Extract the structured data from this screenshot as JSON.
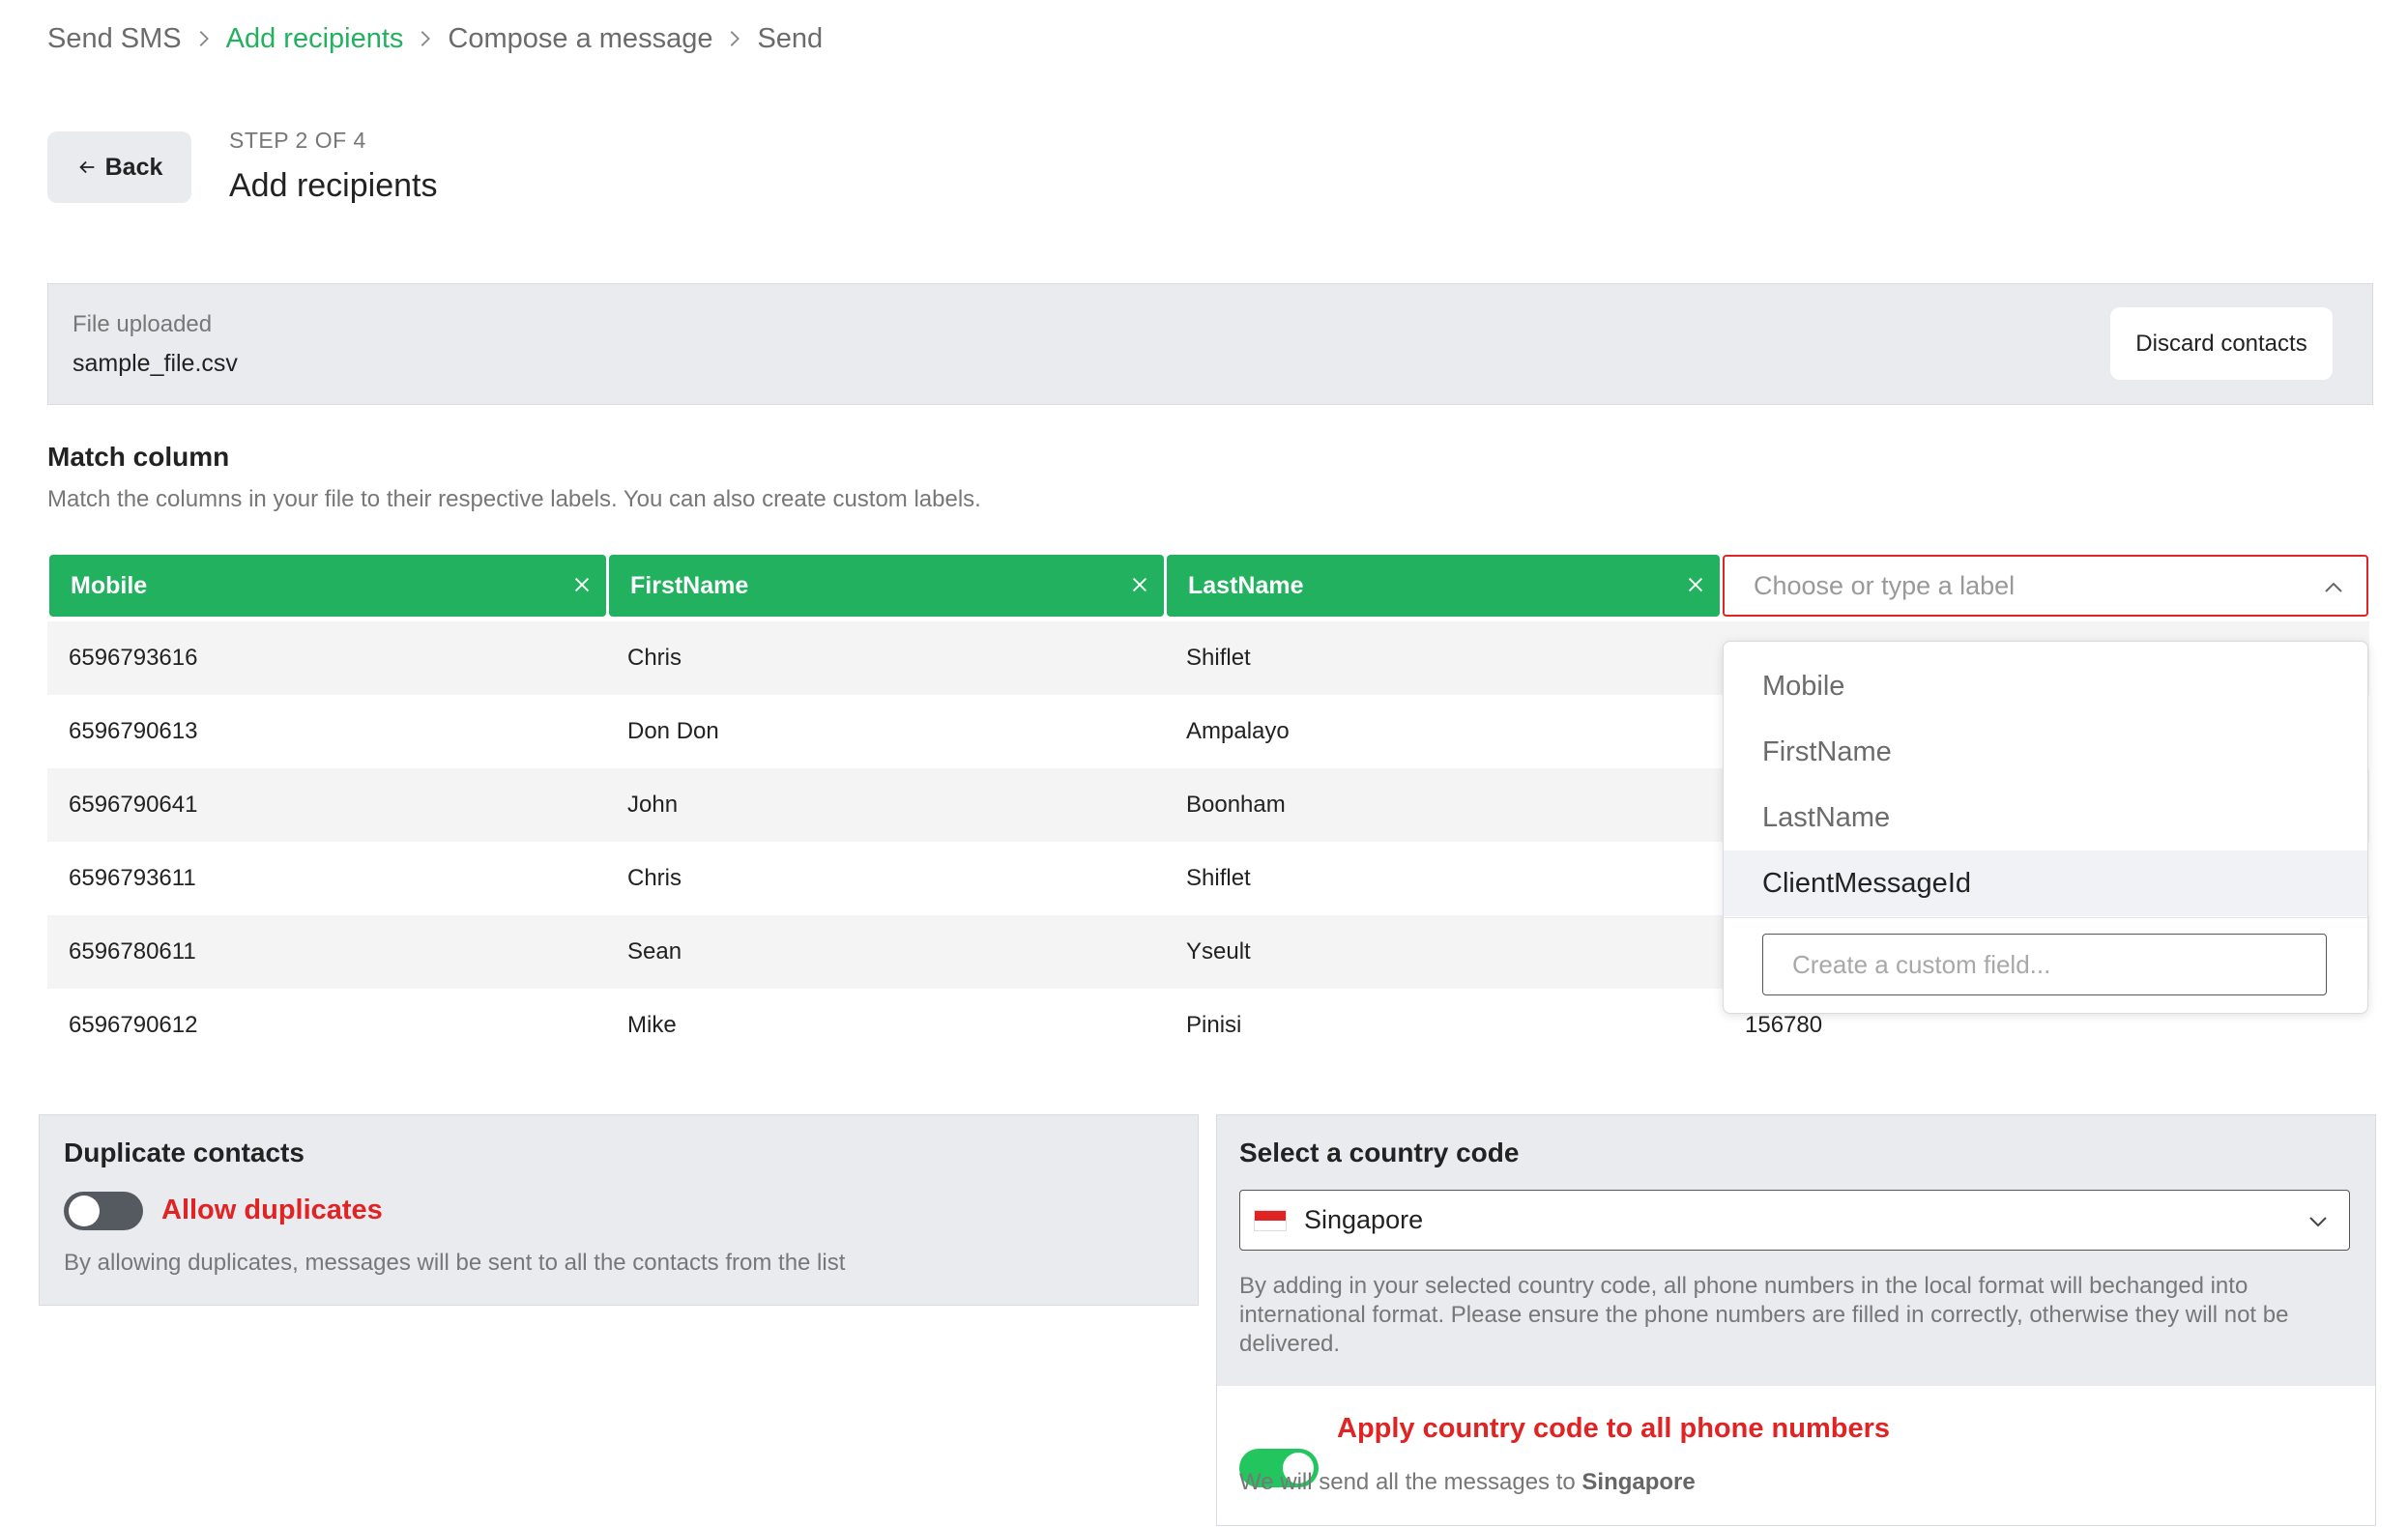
{
  "breadcrumb": {
    "items": [
      "Send SMS",
      "Add recipients",
      "Compose a message",
      "Send"
    ],
    "active_index": 1
  },
  "header": {
    "back_label": "Back",
    "step_label": "STEP 2 OF 4",
    "title": "Add recipients"
  },
  "file": {
    "label": "File uploaded",
    "name": "sample_file.csv",
    "discard_label": "Discard contacts"
  },
  "match": {
    "title": "Match column",
    "description": "Match the columns in your file to their respective labels. You can also create custom labels.",
    "columns": [
      "Mobile",
      "FirstName",
      "LastName"
    ],
    "label_placeholder": "Choose or type a label"
  },
  "rows": [
    [
      "6596793616",
      "Chris",
      "Shiflet",
      ""
    ],
    [
      "6596790613",
      "Don Don",
      "Ampalayo",
      ""
    ],
    [
      "6596790641",
      "John",
      "Boonham",
      ""
    ],
    [
      "6596793611",
      "Chris",
      "Shiflet",
      ""
    ],
    [
      "6596780611",
      "Sean",
      "Yseult",
      ""
    ],
    [
      "6596790612",
      "Mike",
      "Pinisi",
      "156780"
    ]
  ],
  "dropdown": {
    "options": [
      "Mobile",
      "FirstName",
      "LastName",
      "ClientMessageId"
    ],
    "highlighted_index": 3,
    "custom_placeholder": "Create a custom field..."
  },
  "duplicates": {
    "title": "Duplicate contacts",
    "toggle_label": "Allow duplicates",
    "toggle_on": false,
    "helper": "By allowing duplicates, messages will be sent to all the contacts from the list"
  },
  "country": {
    "title": "Select a country code",
    "selected": "Singapore",
    "helper": "By adding in your selected country code, all phone numbers in the local format will bechanged into international format. Please ensure the phone numbers are filled in correctly, otherwise they will not be delivered.",
    "apply_label": "Apply country code to all phone numbers",
    "apply_on": true,
    "note_prefix": "We will send all the messages to",
    "note_country": "Singapore"
  },
  "colors": {
    "accent_green": "#22b25f",
    "error_red": "#e02424",
    "panel_gray": "#e9ebef"
  }
}
